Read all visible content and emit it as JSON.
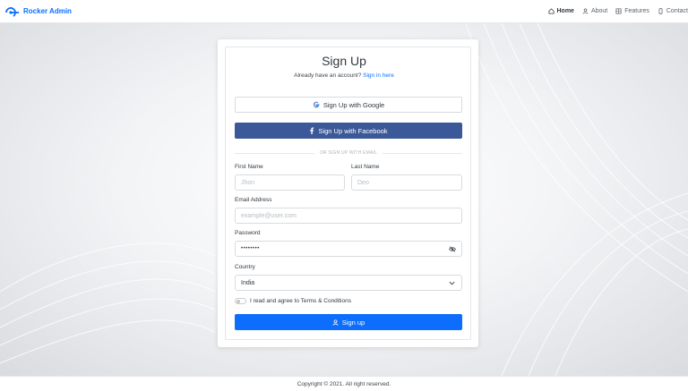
{
  "brand": {
    "name": "Rocker Admin",
    "logo_icon": "rocker-logo-icon"
  },
  "nav": {
    "items": [
      {
        "label": "Home",
        "icon": "home-icon",
        "active": true
      },
      {
        "label": "About",
        "icon": "user-icon",
        "active": false
      },
      {
        "label": "Features",
        "icon": "grid-icon",
        "active": false
      },
      {
        "label": "Contact",
        "icon": "phone-icon",
        "active": false
      }
    ]
  },
  "form": {
    "title": "Sign Up",
    "subtitle_text": "Already have an account?",
    "signin_link": "Sign in here",
    "google_button": "Sign Up with Google",
    "facebook_button": "Sign Up with Facebook",
    "divider_text": "OR SIGN UP WITH EMAIL",
    "first_name": {
      "label": "First Name",
      "placeholder": "Jhon"
    },
    "last_name": {
      "label": "Last Name",
      "placeholder": "Deo"
    },
    "email": {
      "label": "Email Address",
      "placeholder": "example@user.com"
    },
    "password": {
      "label": "Password",
      "value": "••••••••"
    },
    "country": {
      "label": "Country",
      "value": "India"
    },
    "agree_text": "I read and agree to Terms & Conditions",
    "submit_button": "Sign up"
  },
  "footer": {
    "text": "Copyright © 2021. All right reserved."
  },
  "colors": {
    "primary": "#0d6efd",
    "facebook": "#3b5998",
    "brand": "#0d6efd"
  }
}
